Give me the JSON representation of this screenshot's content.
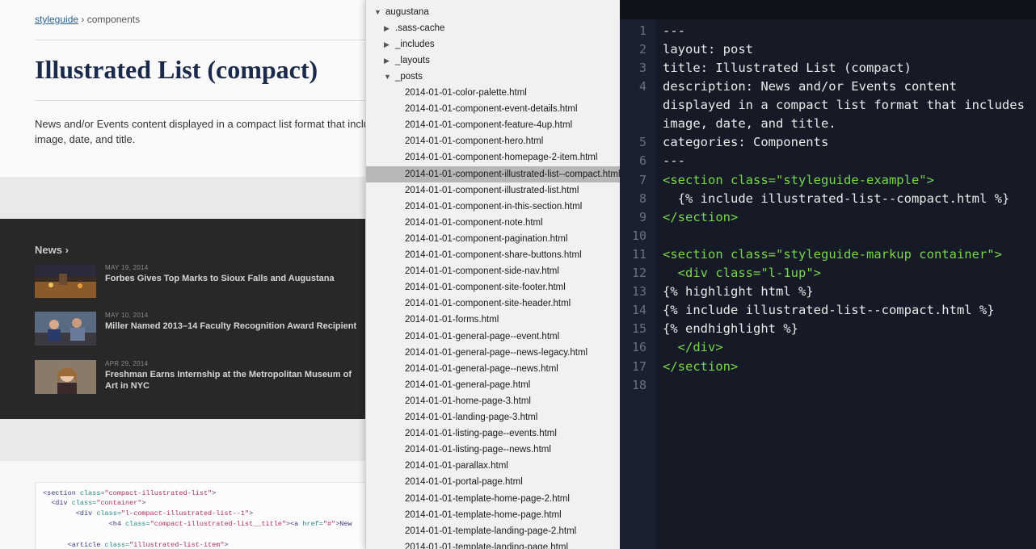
{
  "styleguide": {
    "breadcrumb": {
      "link": "styleguide",
      "sep": "›",
      "current": "components"
    },
    "title": "Illustrated List (compact)",
    "description": "News and/or Events content displayed in a compact list format that includes image, date, and title.",
    "news_heading": "News",
    "news_chevron": "›",
    "news_items": [
      {
        "date": "MAY 19, 2014",
        "headline": "Forbes Gives Top Marks to Sioux Falls and Augustana"
      },
      {
        "date": "MAY 10, 2014",
        "headline": "Miller Named 2013–14 Faculty Recognition Award Recipient"
      },
      {
        "date": "APR 29, 2014",
        "headline": "Freshman Earns Internship at the Metropolitan Museum of Art in NYC"
      }
    ],
    "code_lines": [
      [
        [
          "tg",
          "<section "
        ],
        [
          "at",
          "class="
        ],
        [
          "sv",
          "\"compact-illustrated-list\""
        ],
        [
          "tg",
          ">"
        ]
      ],
      [
        [
          "tg",
          "  <div "
        ],
        [
          "at",
          "class="
        ],
        [
          "sv",
          "\"container\""
        ],
        [
          "tg",
          ">"
        ]
      ],
      [
        [
          "tg",
          "        <div "
        ],
        [
          "at",
          "class="
        ],
        [
          "sv",
          "\"l-compact-illustrated-list--1\""
        ],
        [
          "tg",
          ">"
        ]
      ],
      [
        [
          "tg",
          "                <h4 "
        ],
        [
          "at",
          "class="
        ],
        [
          "sv",
          "\"compact-illustrated-list__title\""
        ],
        [
          "tg",
          "><a "
        ],
        [
          "at",
          "href="
        ],
        [
          "sv",
          "\"#\""
        ],
        [
          "tg",
          ">New"
        ]
      ],
      [
        [
          "tg",
          ""
        ]
      ],
      [
        [
          "tg",
          "      <article "
        ],
        [
          "at",
          "class="
        ],
        [
          "sv",
          "\"illustrated-list-item\""
        ],
        [
          "tg",
          ">"
        ]
      ]
    ]
  },
  "file_tree": {
    "root": "augustana",
    "folders": [
      ".sass-cache",
      "_includes",
      "_layouts"
    ],
    "open_folder": "_posts",
    "files": [
      "2014-01-01-color-palette.html",
      "2014-01-01-component-event-details.html",
      "2014-01-01-component-feature-4up.html",
      "2014-01-01-component-hero.html",
      "2014-01-01-component-homepage-2-item.html",
      "2014-01-01-component-illustrated-list--compact.html",
      "2014-01-01-component-illustrated-list.html",
      "2014-01-01-component-in-this-section.html",
      "2014-01-01-component-note.html",
      "2014-01-01-component-pagination.html",
      "2014-01-01-component-share-buttons.html",
      "2014-01-01-component-side-nav.html",
      "2014-01-01-component-site-footer.html",
      "2014-01-01-component-site-header.html",
      "2014-01-01-forms.html",
      "2014-01-01-general-page--event.html",
      "2014-01-01-general-page--news-legacy.html",
      "2014-01-01-general-page--news.html",
      "2014-01-01-general-page.html",
      "2014-01-01-home-page-3.html",
      "2014-01-01-landing-page-3.html",
      "2014-01-01-listing-page--events.html",
      "2014-01-01-listing-page--news.html",
      "2014-01-01-parallax.html",
      "2014-01-01-portal-page.html",
      "2014-01-01-template-home-page-2.html",
      "2014-01-01-template-home-page.html",
      "2014-01-01-template-landing-page-2.html",
      "2014-01-01-template-landing-page.html"
    ],
    "selected_index": 5
  },
  "editor": {
    "lines": [
      {
        "n": "1",
        "parts": [
          [
            "t",
            "---"
          ]
        ]
      },
      {
        "n": "2",
        "parts": [
          [
            "t",
            "layout: post"
          ]
        ]
      },
      {
        "n": "3",
        "parts": [
          [
            "t",
            "title: Illustrated List (compact)"
          ]
        ]
      },
      {
        "n": "4",
        "parts": [
          [
            "t",
            "description: News and/or Events content displayed in a compact list format that includes image, date, and title."
          ]
        ]
      },
      {
        "n": "5",
        "parts": [
          [
            "t",
            "categories: Components"
          ]
        ]
      },
      {
        "n": "6",
        "parts": [
          [
            "t",
            "---"
          ]
        ]
      },
      {
        "n": "7",
        "parts": [
          [
            "g",
            "<section "
          ],
          [
            "g",
            "class="
          ],
          [
            "g",
            "\"styleguide-example\""
          ],
          [
            "g",
            ">"
          ]
        ]
      },
      {
        "n": "8",
        "parts": [
          [
            "t",
            "  {% include illustrated-list--compact.html %}"
          ]
        ]
      },
      {
        "n": "9",
        "parts": [
          [
            "g",
            "</section>"
          ]
        ]
      },
      {
        "n": "10",
        "parts": [
          [
            "t",
            ""
          ]
        ]
      },
      {
        "n": "11",
        "parts": [
          [
            "g",
            "<section "
          ],
          [
            "g",
            "class="
          ],
          [
            "g",
            "\"styleguide-markup container\""
          ],
          [
            "g",
            ">"
          ]
        ]
      },
      {
        "n": "12",
        "parts": [
          [
            "t",
            "  "
          ],
          [
            "g",
            "<div "
          ],
          [
            "g",
            "class="
          ],
          [
            "g",
            "\"l-1up\""
          ],
          [
            "g",
            ">"
          ]
        ]
      },
      {
        "n": "13",
        "parts": [
          [
            "t",
            "{% highlight html %}"
          ]
        ]
      },
      {
        "n": "14",
        "parts": [
          [
            "t",
            "{% include illustrated-list--compact.html %}"
          ]
        ]
      },
      {
        "n": "15",
        "parts": [
          [
            "t",
            "{% endhighlight %}"
          ]
        ]
      },
      {
        "n": "16",
        "parts": [
          [
            "t",
            "  "
          ],
          [
            "g",
            "</div>"
          ]
        ]
      },
      {
        "n": "17",
        "parts": [
          [
            "g",
            "</section>"
          ]
        ]
      },
      {
        "n": "18",
        "parts": [
          [
            "t",
            ""
          ]
        ]
      }
    ]
  },
  "colors": {
    "editor_bg": "#161a26",
    "editor_tag": "#78d64b",
    "tree_selected": "#b7b7b7",
    "news_bg": "#282828",
    "title_navy": "#1b2a4a"
  }
}
